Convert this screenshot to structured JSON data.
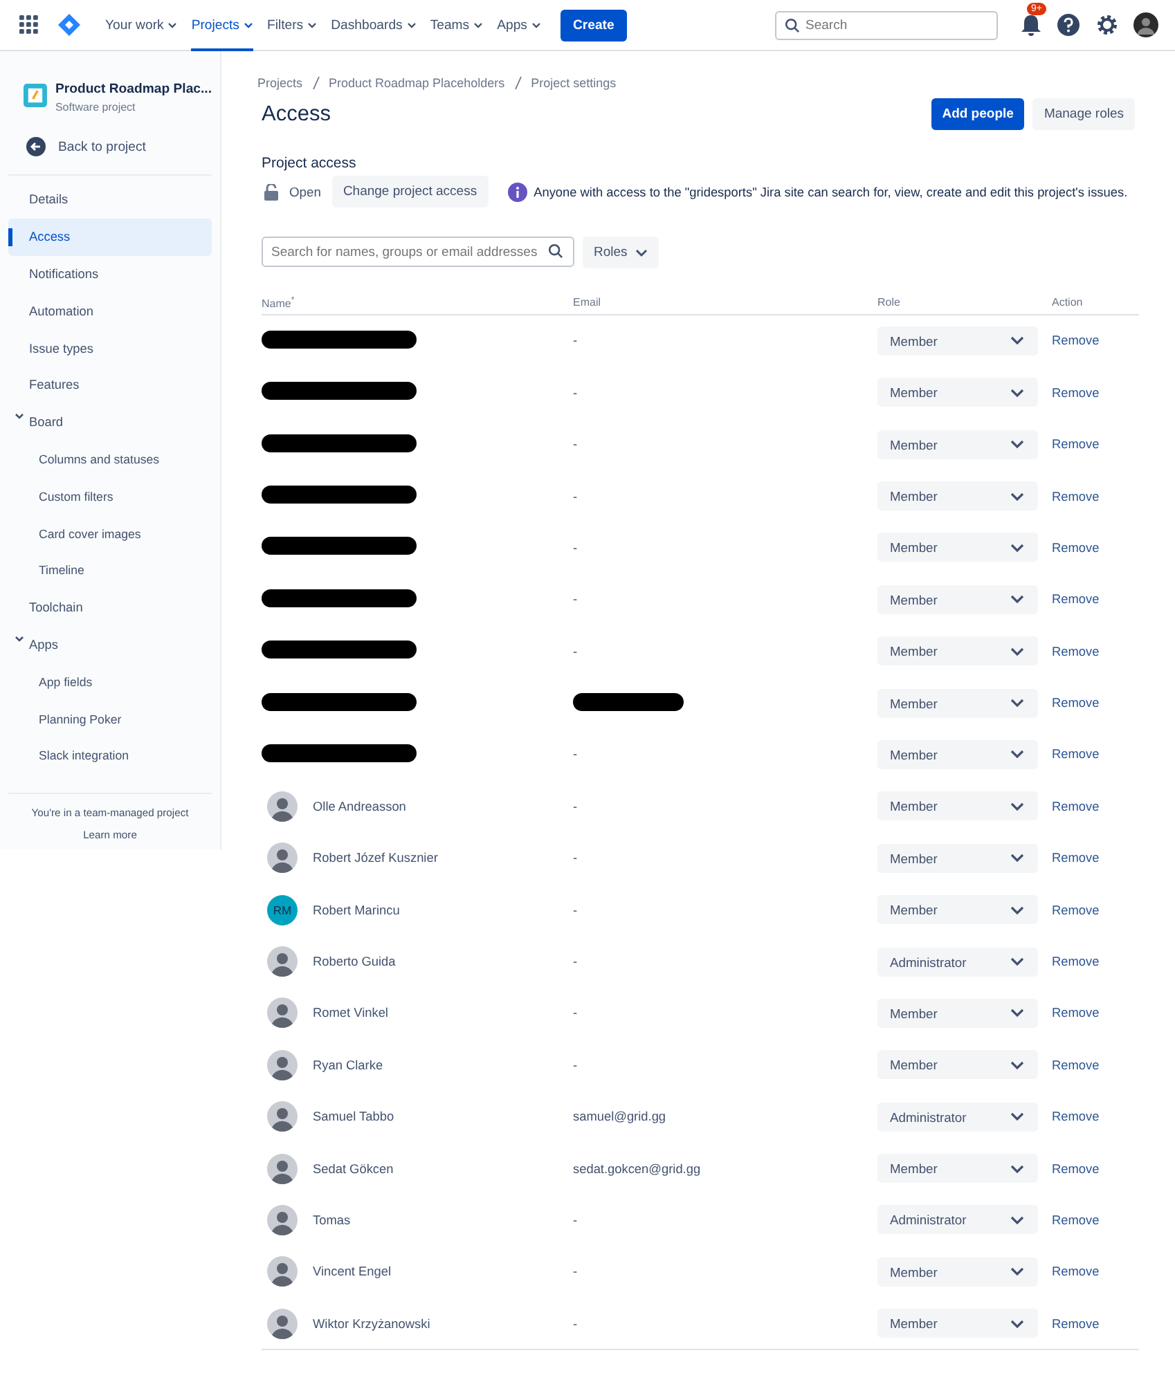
{
  "top_nav": {
    "items": [
      {
        "label": "Your work",
        "selected": false
      },
      {
        "label": "Projects",
        "selected": true
      },
      {
        "label": "Filters",
        "selected": false
      },
      {
        "label": "Dashboards",
        "selected": false
      },
      {
        "label": "Teams",
        "selected": false
      },
      {
        "label": "Apps",
        "selected": false
      }
    ],
    "create": "Create",
    "search": {
      "placeholder": "Search"
    },
    "notification_badge": "9+"
  },
  "sidebar": {
    "project_name": "Product Roadmap Plac...",
    "project_type": "Software project",
    "back": "Back to project",
    "items": [
      {
        "label": "Details",
        "selected": false
      },
      {
        "label": "Access",
        "selected": true
      },
      {
        "label": "Notifications",
        "selected": false
      },
      {
        "label": "Automation",
        "selected": false
      },
      {
        "label": "Issue types",
        "selected": false
      },
      {
        "label": "Features",
        "selected": false
      },
      {
        "label": "Board",
        "selected": false,
        "expanded": true,
        "children": [
          {
            "label": "Columns and statuses",
            "selected": false
          },
          {
            "label": "Custom filters",
            "selected": false
          },
          {
            "label": "Card cover images",
            "selected": false
          },
          {
            "label": "Timeline",
            "selected": false
          }
        ]
      },
      {
        "label": "Toolchain",
        "selected": false
      },
      {
        "label": "Apps",
        "selected": false,
        "expanded": true,
        "children": [
          {
            "label": "App fields",
            "selected": false
          },
          {
            "label": "Planning Poker",
            "selected": false
          },
          {
            "label": "Slack integration",
            "selected": false
          }
        ]
      }
    ],
    "footer": "You're in a team-managed project",
    "learn_more": "Learn more"
  },
  "breadcrumbs": [
    "Projects",
    "Product Roadmap Placeholders",
    "Project settings"
  ],
  "title": "Access",
  "buttons": {
    "primary": "Add people",
    "secondary": "Manage roles"
  },
  "project_access": {
    "heading": "Project access",
    "status": "Open",
    "change_button": "Change project access",
    "info": "Anyone with access to the \"gridesports\" Jira site can search for, view, create and edit this project's issues."
  },
  "filter": {
    "placeholder": "Search for names, groups or email addresses",
    "roles_button": "Roles"
  },
  "table": {
    "columns": [
      "Name",
      "Email",
      "Role",
      "Action"
    ],
    "sort_mark": "*",
    "rows": [
      {
        "name_redacted": true,
        "email_redacted": false,
        "email": "-",
        "role": "Member",
        "action": "Remove"
      },
      {
        "name_redacted": true,
        "email_redacted": false,
        "email": "-",
        "role": "Member",
        "action": "Remove"
      },
      {
        "name_redacted": true,
        "email_redacted": false,
        "email": "-",
        "role": "Member",
        "action": "Remove"
      },
      {
        "name_redacted": true,
        "email_redacted": false,
        "email": "-",
        "role": "Member",
        "action": "Remove"
      },
      {
        "name_redacted": true,
        "email_redacted": false,
        "email": "-",
        "role": "Member",
        "action": "Remove"
      },
      {
        "name_redacted": true,
        "email_redacted": false,
        "email": "-",
        "role": "Member",
        "action": "Remove"
      },
      {
        "name_redacted": true,
        "email_redacted": false,
        "email": "-",
        "role": "Member",
        "action": "Remove"
      },
      {
        "name_redacted": true,
        "email_redacted": true,
        "role": "Member",
        "action": "Remove"
      },
      {
        "name_redacted": true,
        "email_redacted": false,
        "email": "-",
        "role": "Member",
        "action": "Remove"
      },
      {
        "name_redacted": false,
        "avatar": {
          "kind": "photo"
        },
        "name": "Olle Andreasson",
        "email_redacted": false,
        "email": "-",
        "role": "Member",
        "action": "Remove"
      },
      {
        "name_redacted": false,
        "avatar": {
          "kind": "photo"
        },
        "name": "Robert Józef Kusznier",
        "email_redacted": false,
        "email": "-",
        "role": "Member",
        "action": "Remove"
      },
      {
        "name_redacted": false,
        "avatar": {
          "kind": "initials",
          "initials": "RM"
        },
        "name": "Robert Marincu",
        "email_redacted": false,
        "email": "-",
        "role": "Member",
        "action": "Remove"
      },
      {
        "name_redacted": false,
        "avatar": {
          "kind": "photo"
        },
        "name": "Roberto Guida",
        "email_redacted": false,
        "email": "-",
        "role": "Administrator",
        "action": "Remove"
      },
      {
        "name_redacted": false,
        "avatar": {
          "kind": "photo"
        },
        "name": "Romet Vinkel",
        "email_redacted": false,
        "email": "-",
        "role": "Member",
        "action": "Remove"
      },
      {
        "name_redacted": false,
        "avatar": {
          "kind": "photo"
        },
        "name": "Ryan Clarke",
        "email_redacted": false,
        "email": "-",
        "role": "Member",
        "action": "Remove"
      },
      {
        "name_redacted": false,
        "avatar": {
          "kind": "photo"
        },
        "name": "Samuel Tabbo",
        "email_redacted": false,
        "email": "samuel@grid.gg",
        "role": "Administrator",
        "action": "Remove"
      },
      {
        "name_redacted": false,
        "avatar": {
          "kind": "photo"
        },
        "name": "Sedat Gökcen",
        "email_redacted": false,
        "email": "sedat.gokcen@grid.gg",
        "role": "Member",
        "action": "Remove"
      },
      {
        "name_redacted": false,
        "avatar": {
          "kind": "photo"
        },
        "name": "Tomas",
        "email_redacted": false,
        "email": "-",
        "role": "Administrator",
        "action": "Remove"
      },
      {
        "name_redacted": false,
        "avatar": {
          "kind": "photo"
        },
        "name": "Vincent Engel",
        "email_redacted": false,
        "email": "-",
        "role": "Member",
        "action": "Remove"
      },
      {
        "name_redacted": false,
        "avatar": {
          "kind": "photo"
        },
        "name": "Wiktor Krzyżanowski",
        "email_redacted": false,
        "email": "-",
        "role": "Member",
        "action": "Remove"
      }
    ]
  }
}
